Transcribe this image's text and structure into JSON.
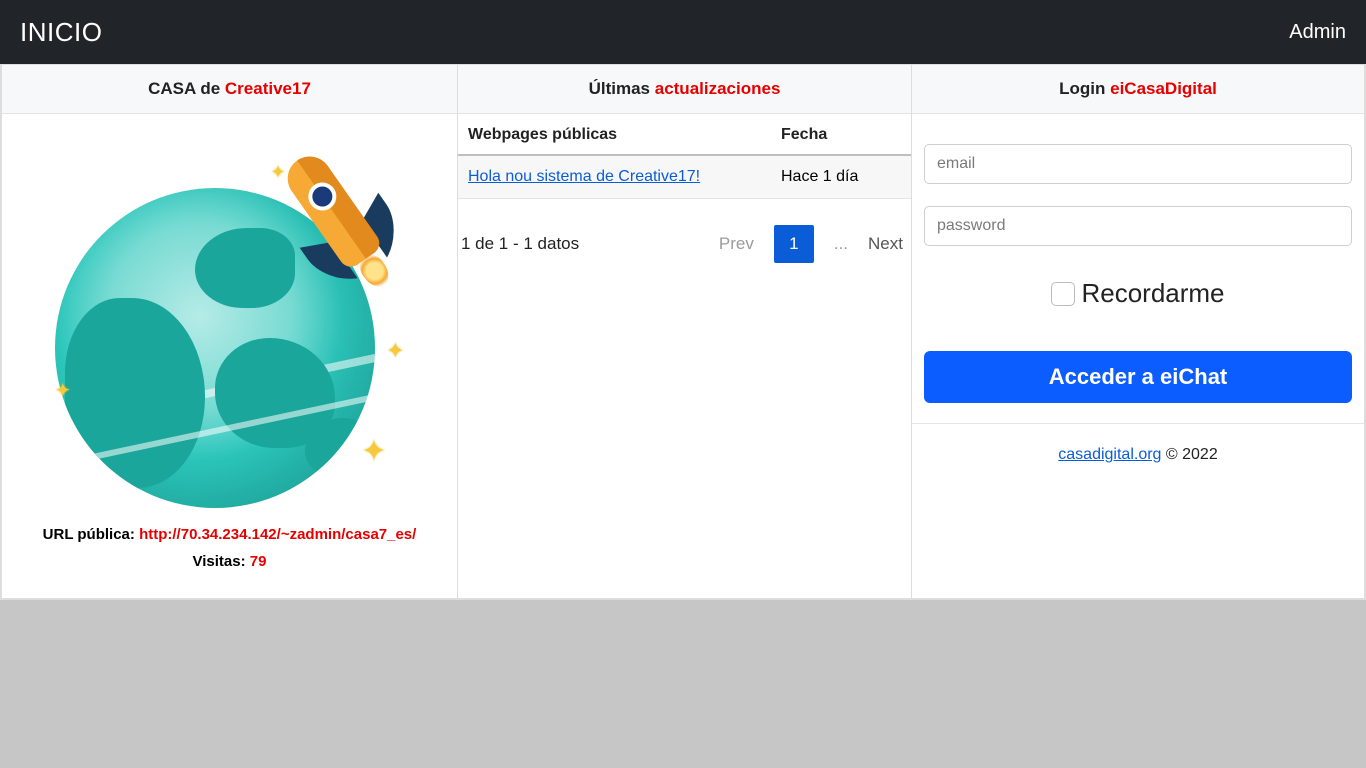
{
  "nav": {
    "brand": "INICIO",
    "admin": "Admin"
  },
  "col1": {
    "title_prefix": "CASA de ",
    "title_accent": "Creative17",
    "url_label": "URL pública: ",
    "url_value": "http://70.34.234.142/~zadmin/casa7_es/",
    "visits_label": "Visitas: ",
    "visits_value": "79"
  },
  "col2": {
    "title_prefix": "Últimas ",
    "title_accent": "actualizaciones",
    "th_page": "Webpages públicas",
    "th_date": "Fecha",
    "row_link": "Hola nou sistema de Creative17!",
    "row_date": "Hace 1 día",
    "count_text": "1 de 1 - 1 datos",
    "prev": "Prev",
    "page": "1",
    "ellipsis": "...",
    "next": "Next"
  },
  "col3": {
    "title_prefix": "Login ",
    "title_accent": "eiCasaDigital",
    "email_ph": "email",
    "pass_ph": "password",
    "remember": "Recordarme",
    "button": "Acceder a eiChat",
    "footer_link": "casadigital.org",
    "footer_rest": " © 2022"
  }
}
